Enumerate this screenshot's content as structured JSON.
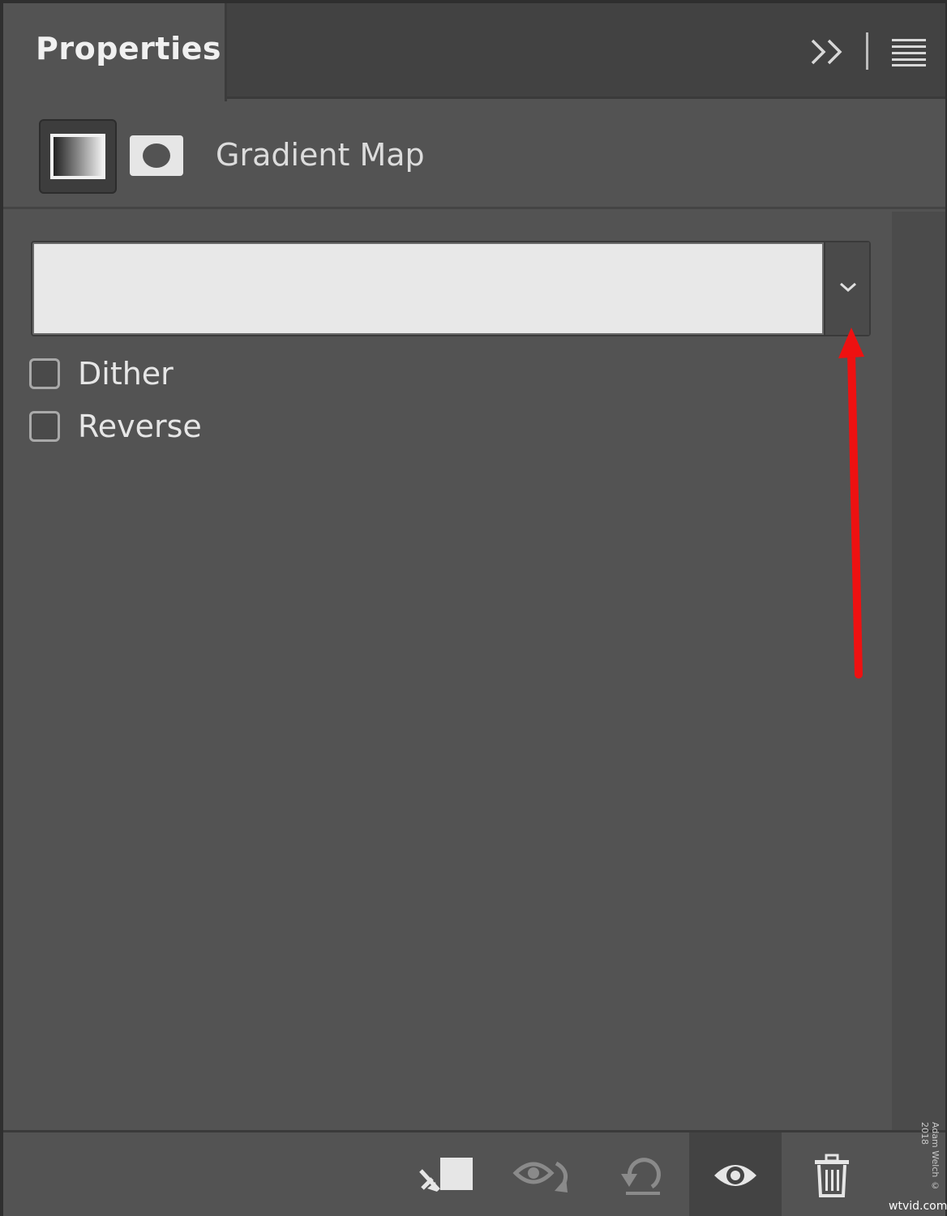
{
  "panel": {
    "tab_title": "Properties",
    "adjustment_title": "Gradient Map"
  },
  "icons": {
    "collapse": "double-chevron-right-icon",
    "menu": "hamburger-menu-icon",
    "gradient_adjustment": "gradient-adjustment-icon",
    "layer_mask": "layer-mask-icon",
    "dropdown": "chevron-down-icon"
  },
  "gradient": {
    "swatch_color": "#e8e8e8"
  },
  "options": {
    "dither_label": "Dither",
    "dither_checked": false,
    "reverse_label": "Reverse",
    "reverse_checked": false
  },
  "annotation": {
    "arrow_color": "#ee1111"
  },
  "footer": {
    "buttons": [
      "clip-to-layer-icon",
      "view-previous-state-icon",
      "reset-adjustment-icon",
      "toggle-visibility-icon",
      "delete-layer-icon"
    ]
  },
  "watermark": {
    "credit": "Adam Welch © 2018",
    "site": "wtvid.com"
  }
}
